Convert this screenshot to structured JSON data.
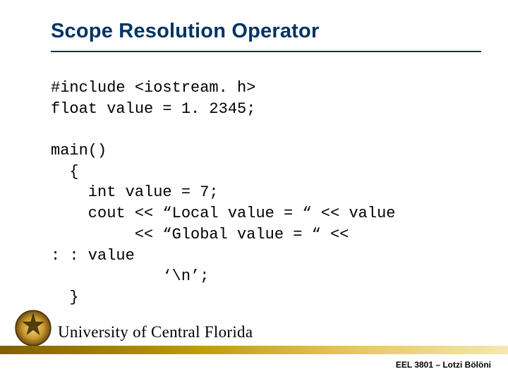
{
  "slide": {
    "title": "Scope Resolution Operator",
    "code": "#include <iostream. h>\nfloat value = 1. 2345;\n\nmain()\n  {\n    int value = 7;\n    cout << “Local value = “ << value\n         << “Global value = “ <<\n: : value\n            ‘\\n’;\n  }",
    "footer": {
      "university": "University of Central Florida",
      "credit": "EEL 3801 – Lotzi Bölöni"
    }
  }
}
